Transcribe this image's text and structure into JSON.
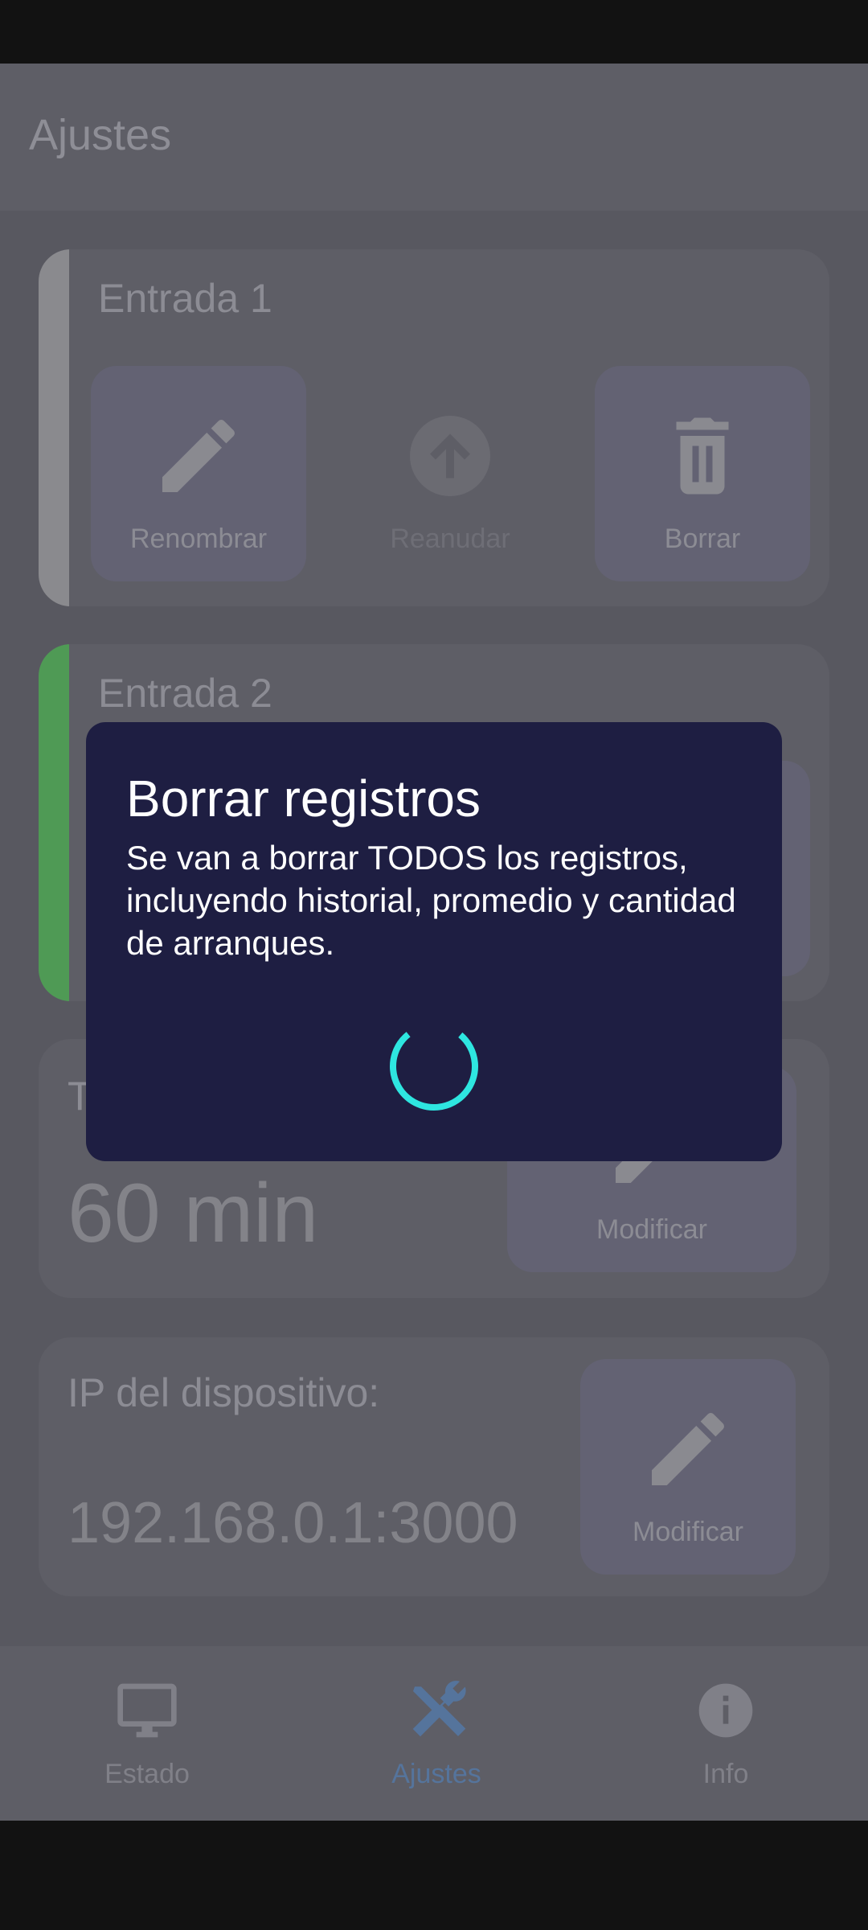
{
  "app_bar": {
    "title": "Ajustes"
  },
  "cards": {
    "entrada1": {
      "title": "Entrada 1",
      "stripe_color": "#8a8a8e",
      "actions": {
        "rename": "Renombrar",
        "resume": "Reanudar",
        "delete": "Borrar"
      }
    },
    "entrada2": {
      "title": "Entrada 2",
      "stripe_color": "#4f9a55"
    },
    "time": {
      "title_visible": "T",
      "value": "60 min",
      "modify": "Modificar"
    },
    "ip": {
      "label": "IP del dispositivo:",
      "value": "192.168.0.1:3000",
      "modify": "Modificar"
    }
  },
  "bottom_nav": {
    "items": [
      {
        "label": "Estado",
        "icon": "monitor-icon"
      },
      {
        "label": "Ajustes",
        "icon": "tools-icon",
        "active": true
      },
      {
        "label": "Info",
        "icon": "info-icon"
      }
    ],
    "active_color": "#55749c"
  },
  "dialog": {
    "title": "Borrar registros",
    "message": "Se van a borrar TODOS los registros, incluyendo historial, promedio y cantidad de arranques.",
    "spinner_color": "#2ee6e0"
  }
}
